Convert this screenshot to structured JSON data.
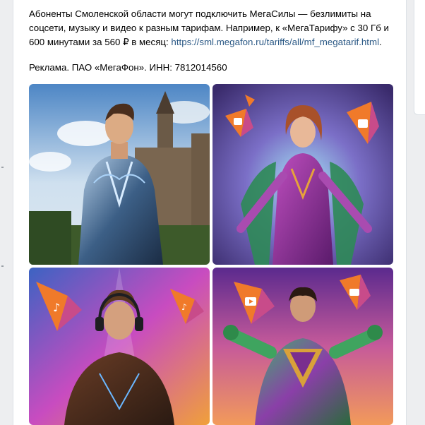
{
  "post": {
    "text": "Абоненты Смоленской области могут подключить МегаСилы — безлимиты на соцсети, музыку и видео к разным тарифам. Например, к «МегаТарифу» с 30 Гб и 600 минутами за 560 ₽ в месяц: ",
    "link": "https://sml.megafon.ru/tariffs/all/mf_megatarif.html",
    "link_suffix": ".",
    "ad_label": "Реклама. ПАО «МегаФон». ИНН: 7812014560"
  },
  "photos": [
    {
      "name": "photo-knight-castle",
      "icon": "none"
    },
    {
      "name": "photo-heroine-purple",
      "icon": "social-icon"
    },
    {
      "name": "photo-hero-headphones",
      "icon": "music-icon"
    },
    {
      "name": "photo-hero-green",
      "icon": "video-play-icon"
    }
  ],
  "colors": {
    "link": "#2a5885",
    "accent_orange": "#f07a2a",
    "accent_purple": "#8e2ca8",
    "background": "#edeef0"
  }
}
